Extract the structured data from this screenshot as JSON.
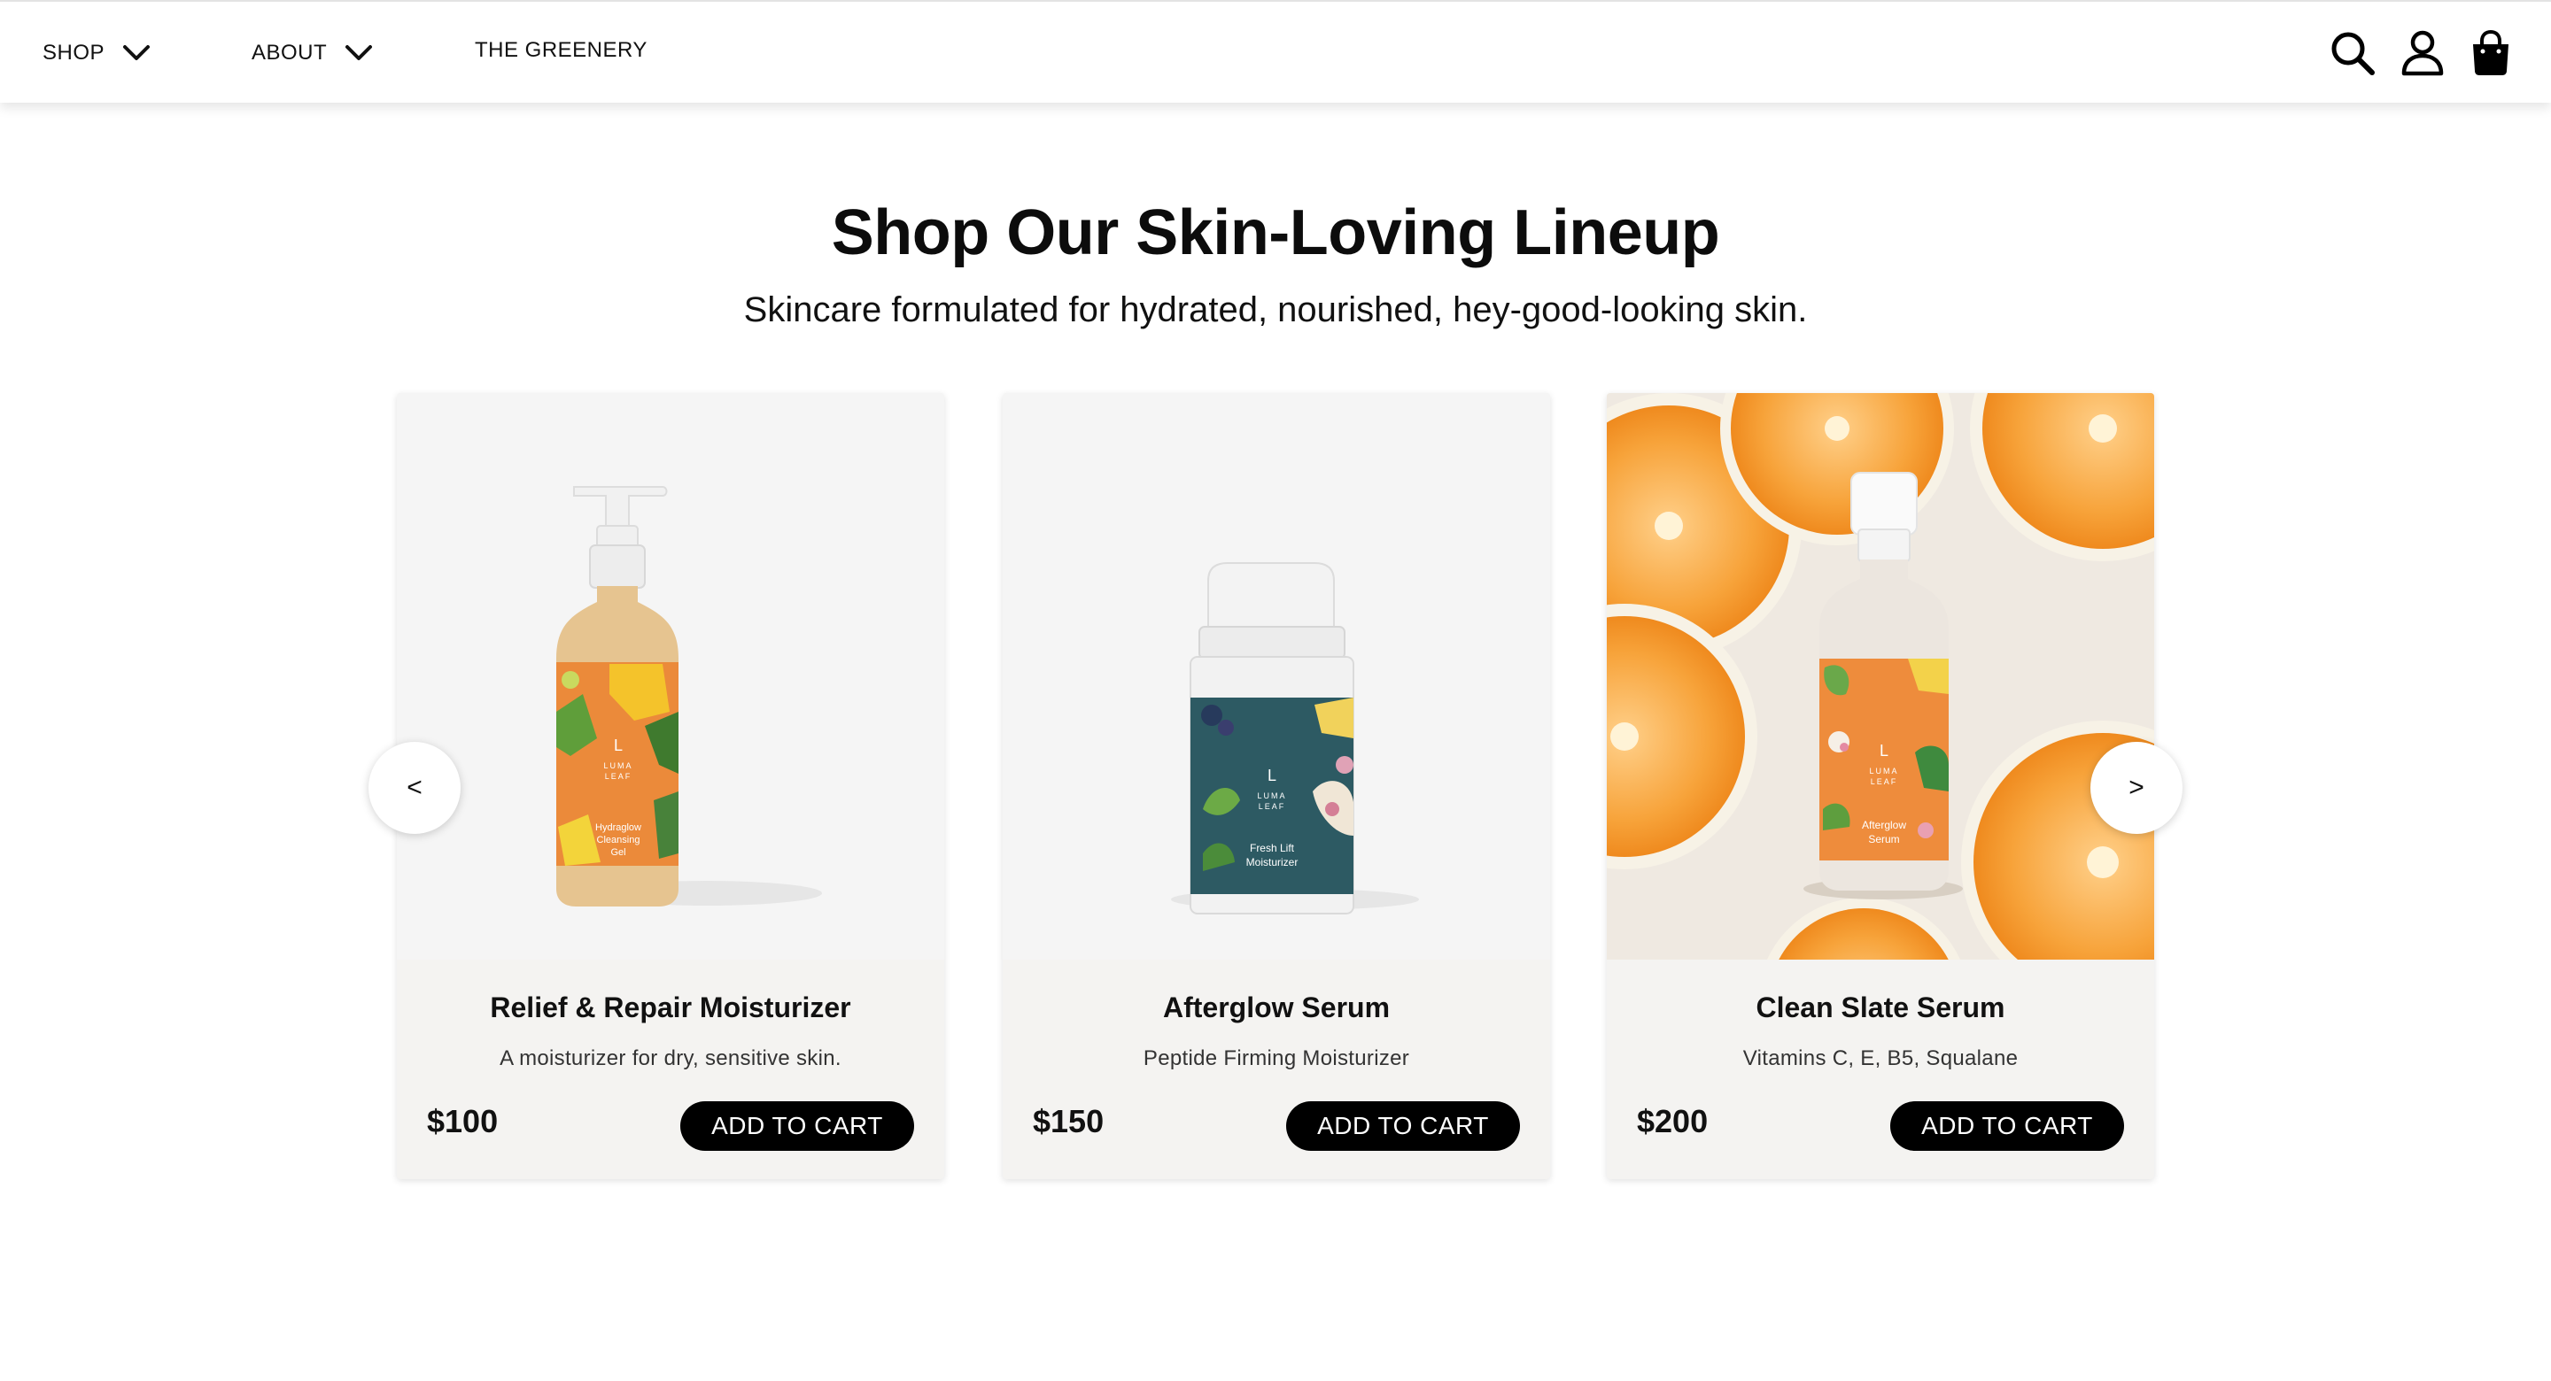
{
  "nav": {
    "items": [
      {
        "label": "SHOP",
        "has_dropdown": true
      },
      {
        "label": "ABOUT",
        "has_dropdown": true
      },
      {
        "label": "THE GREENERY",
        "has_dropdown": false
      }
    ],
    "icons": [
      "search-icon",
      "account-icon",
      "shopping-bag-icon"
    ]
  },
  "hero": {
    "title": "Shop Our Skin-Loving Lineup",
    "subtitle": "Skincare formulated for hydrated, nourished, hey-good-looking skin."
  },
  "carousel": {
    "prev_label": "<",
    "next_label": ">"
  },
  "products": [
    {
      "name": "Relief & Repair Moisturizer",
      "description": "A moisturizer for dry, sensitive skin.",
      "price": "$100",
      "button_label": "ADD TO CART",
      "image": {
        "brand": "LUMA LEAF",
        "label": "Hydraglow Cleansing Gel",
        "type": "pump bottle",
        "label_color": "#e98a3a"
      }
    },
    {
      "name": "Afterglow Serum",
      "description": "Peptide Firming Moisturizer",
      "price": "$150",
      "button_label": "ADD TO CART",
      "image": {
        "brand": "LUMA LEAF",
        "label": "Fresh Lift Moisturizer",
        "type": "airless jar",
        "label_color": "#2d5a63"
      }
    },
    {
      "name": "Clean Slate Serum",
      "description": "Vitamins C, E, B5, Squalane",
      "price": "$200",
      "button_label": "ADD TO CART",
      "image": {
        "brand": "LUMA LEAF",
        "label": "Afterglow Serum",
        "type": "serum bottle with orange slices",
        "label_color": "#ee8c3c"
      }
    }
  ],
  "colors": {
    "text": "#111111",
    "button_bg": "#000000",
    "button_text": "#ffffff",
    "card_bg": "#f4f3f1",
    "orange": "#f39a2e"
  }
}
